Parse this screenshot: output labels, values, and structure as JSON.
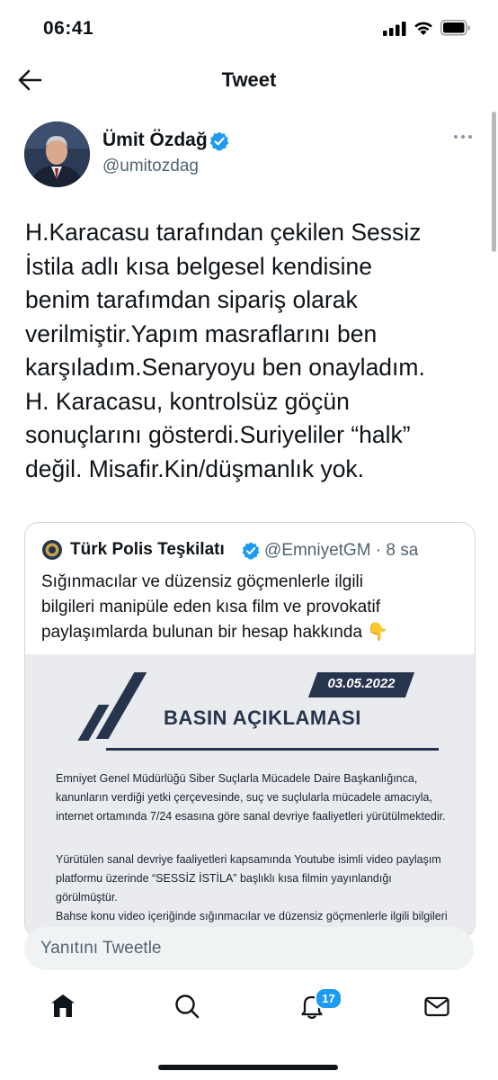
{
  "status_bar": {
    "time": "06:41"
  },
  "header": {
    "title": "Tweet"
  },
  "tweet": {
    "author_name": "Ümit Özdağ",
    "author_handle": "@umitozdag",
    "text": "H.Karacasu tarafından çekilen Sessiz\nİstila adlı kısa belgesel kendisine\nbenim tarafımdan sipariş olarak\nverilmiştir.Yapım masraflarını ben\nkarşıladım.Senaryoyu ben onayladım.\nH. Karacasu, kontrolsüz göçün\nsonuçlarını gösterdi.Suriyeliler “halk”\ndeğil. Misafir.Kin/düşmanlık yok."
  },
  "quote": {
    "author_name": "Türk Polis Teşkilatı",
    "meta": "@EmniyetGM · 8 sa",
    "text": "Sığınmacılar ve düzensiz göçmenlerle ilgili\nbilgileri manipüle eden kısa film ve provokatif\npaylaşımlarda bulunan bir hesap hakkında 👇",
    "image": {
      "date": "03.05.2022",
      "title": "BASIN AÇIKLAMASI",
      "paragraph1": "Emniyet Genel Müdürlüğü Siber Suçlarla Mücadele Daire Başkanlığınca,\nkanunların verdiği yetki çerçevesinde, suç ve suçlularla mücadele amacıyla,\ninternet ortamında 7/24 esasına göre sanal devriye faaliyetleri yürütülmektedir.",
      "paragraph2": "Yürütülen sanal devriye faaliyetleri kapsamında Youtube isimli video paylaşım\nplatformu üzerinde “SESSİZ İSTİLA” başlıklı kısa filmin yayınlandığı görülmüştür.\nBahse konu video içeriğinde sığınmacılar ve düzensiz göçmenlerle ilgili bilgileri\nmanipüle edip gerçekleri çarpıtarak yayınlayan H.K. isimli şahıs Sakarya'da,"
    }
  },
  "reply": {
    "placeholder": "Yanıtını Tweetle"
  },
  "tabbar": {
    "notifications_count": "17"
  },
  "colors": {
    "accent": "#1d9bf0",
    "text": "#0f1419",
    "secondary": "#536471",
    "navy": "#27344d"
  }
}
